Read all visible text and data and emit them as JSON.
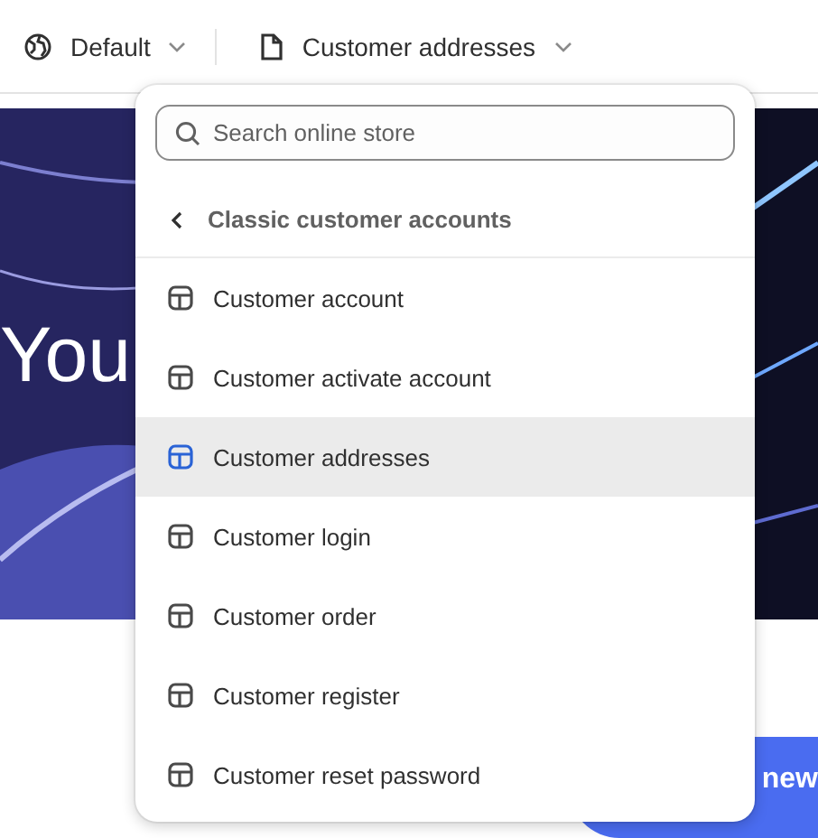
{
  "toolbar": {
    "theme_menu": {
      "label": "Default"
    },
    "template_menu": {
      "label": "Customer addresses"
    }
  },
  "hero": {
    "heading": "You"
  },
  "button": {
    "label": "new"
  },
  "dropdown": {
    "search": {
      "placeholder": "Search online store"
    },
    "back": {
      "label": "Classic customer accounts"
    },
    "items": [
      {
        "label": "Customer account",
        "selected": false
      },
      {
        "label": "Customer activate account",
        "selected": false
      },
      {
        "label": "Customer addresses",
        "selected": true
      },
      {
        "label": "Customer login",
        "selected": false
      },
      {
        "label": "Customer order",
        "selected": false
      },
      {
        "label": "Customer register",
        "selected": false
      },
      {
        "label": "Customer reset password",
        "selected": false
      }
    ]
  }
}
